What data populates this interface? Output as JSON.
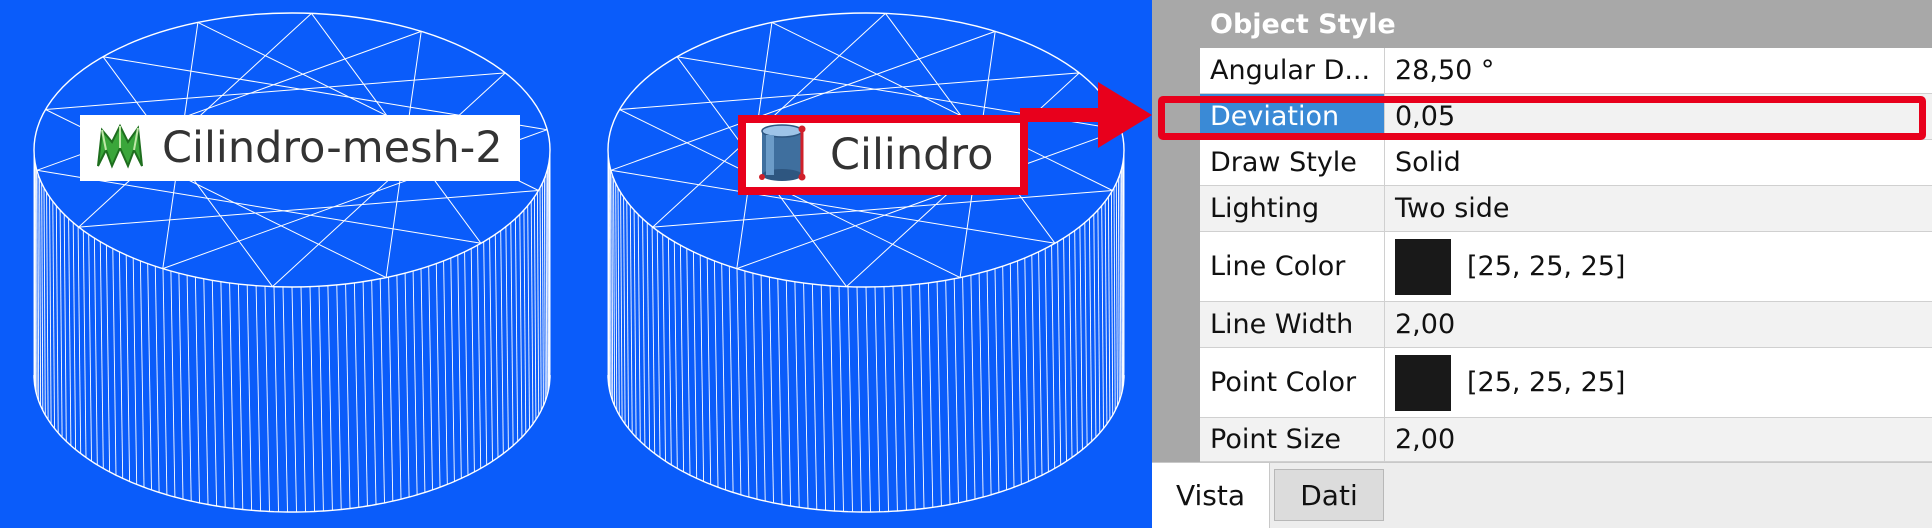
{
  "viewport": {
    "background": "#0a5cfa",
    "objects": [
      {
        "label": "Cilindro-mesh-2",
        "icon": "mesh-icon"
      },
      {
        "label": "Cilindro",
        "icon": "cylinder-icon"
      }
    ]
  },
  "property_panel": {
    "group_header": "Object Style",
    "rows": [
      {
        "name": "Angular D...",
        "value": "28,50 °"
      },
      {
        "name": "Deviation",
        "value": "0,05",
        "selected": true
      },
      {
        "name": "Draw Style",
        "value": "Solid"
      },
      {
        "name": "Lighting",
        "value": "Two side"
      },
      {
        "name": "Line Color",
        "value": "[25, 25, 25]",
        "swatch": "#191919"
      },
      {
        "name": "Line Width",
        "value": "2,00"
      },
      {
        "name": "Point Color",
        "value": "[25, 25, 25]",
        "swatch": "#191919"
      },
      {
        "name": "Point Size",
        "value": "2,00"
      }
    ],
    "tabs": [
      "Vista",
      "Dati"
    ],
    "active_tab": "Vista"
  },
  "annotation": {
    "color": "#e8001c"
  }
}
